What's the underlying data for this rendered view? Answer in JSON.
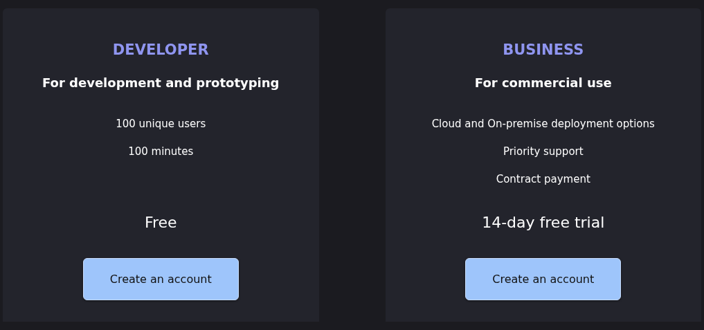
{
  "plans": [
    {
      "name": "DEVELOPER",
      "tagline": "For development and prototyping",
      "features": [
        "100 unique users",
        "100 minutes"
      ],
      "price": "Free",
      "button": "Create an account"
    },
    {
      "name": "BUSINESS",
      "tagline": "For commercial use",
      "features": [
        "Cloud and On-premise deployment options",
        "Priority support",
        "Contract payment"
      ],
      "price": "14-day free trial",
      "button": "Create an account"
    }
  ]
}
